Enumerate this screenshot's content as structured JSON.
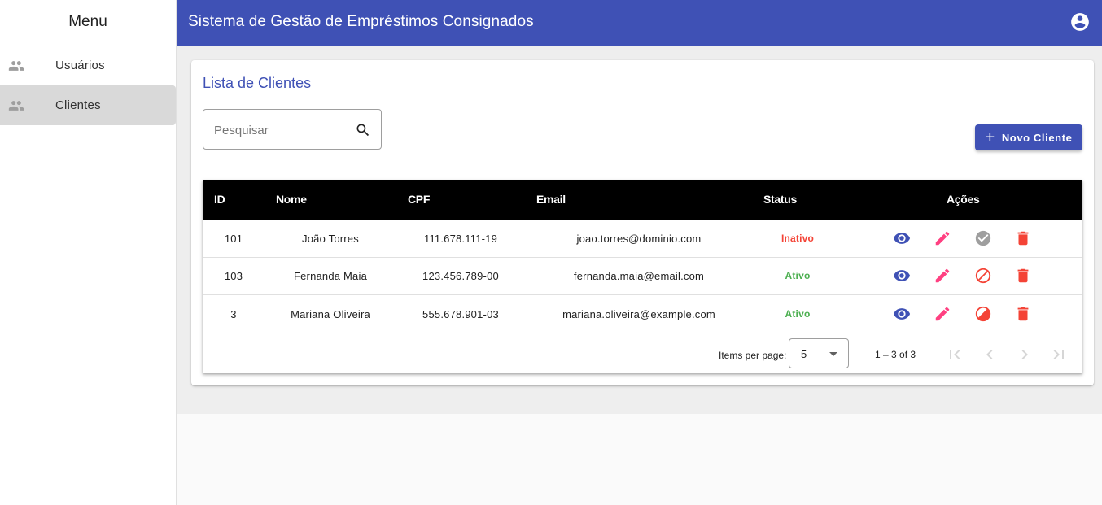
{
  "sidebar": {
    "title": "Menu",
    "items": [
      {
        "label": "Usuários",
        "icon": "people-icon",
        "active": false
      },
      {
        "label": "Clientes",
        "icon": "people-icon",
        "active": true
      }
    ]
  },
  "header": {
    "title": "Sistema de Gestão de Empréstimos Consignados",
    "account_icon": "account-circle-icon",
    "color": "#3f51b5"
  },
  "card": {
    "title": "Lista de Clientes"
  },
  "search": {
    "placeholder": "Pesquisar",
    "value": ""
  },
  "new_button": {
    "label": "Novo Cliente",
    "icon": "plus-icon"
  },
  "table": {
    "columns": [
      "ID",
      "Nome",
      "CPF",
      "Email",
      "Status",
      "Ações"
    ],
    "rows": [
      {
        "id": "101",
        "nome": "João Torres",
        "cpf": "111.678.111-19",
        "email": "joao.torres@dominio.com",
        "status": "Inativo"
      },
      {
        "id": "103",
        "nome": "Fernanda Maia",
        "cpf": "123.456.789-00",
        "email": "fernanda.maia@email.com",
        "status": "Ativo"
      },
      {
        "id": "3",
        "nome": "Mariana Oliveira",
        "cpf": "555.678.901-03",
        "email": "mariana.oliveira@example.com",
        "status": "Ativo"
      }
    ],
    "status_colors": {
      "Ativo": "#4caf50",
      "Inativo": "#f44336"
    },
    "action_icons": [
      "eye-icon",
      "pencil-icon",
      "check-circle-icon / block-icon",
      "trash-icon"
    ]
  },
  "paginator": {
    "items_per_page_label": "Items per page:",
    "page_size": "5",
    "range_label": "1 – 3 of 3"
  }
}
